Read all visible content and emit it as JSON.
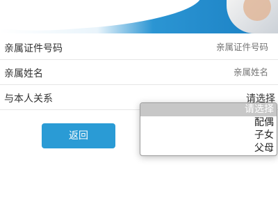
{
  "fields": {
    "id_number": {
      "label": "亲属证件号码",
      "placeholder": "亲属证件号码"
    },
    "name": {
      "label": "亲属姓名",
      "placeholder": "亲属姓名"
    },
    "relation": {
      "label": "与本人关系",
      "value": "请选择"
    }
  },
  "back_button": {
    "label": "返回",
    "color": "#2a9bd5"
  },
  "dropdown": {
    "options": [
      "请选择",
      "配偶",
      "子女",
      "父母"
    ],
    "selected_index": 0
  }
}
